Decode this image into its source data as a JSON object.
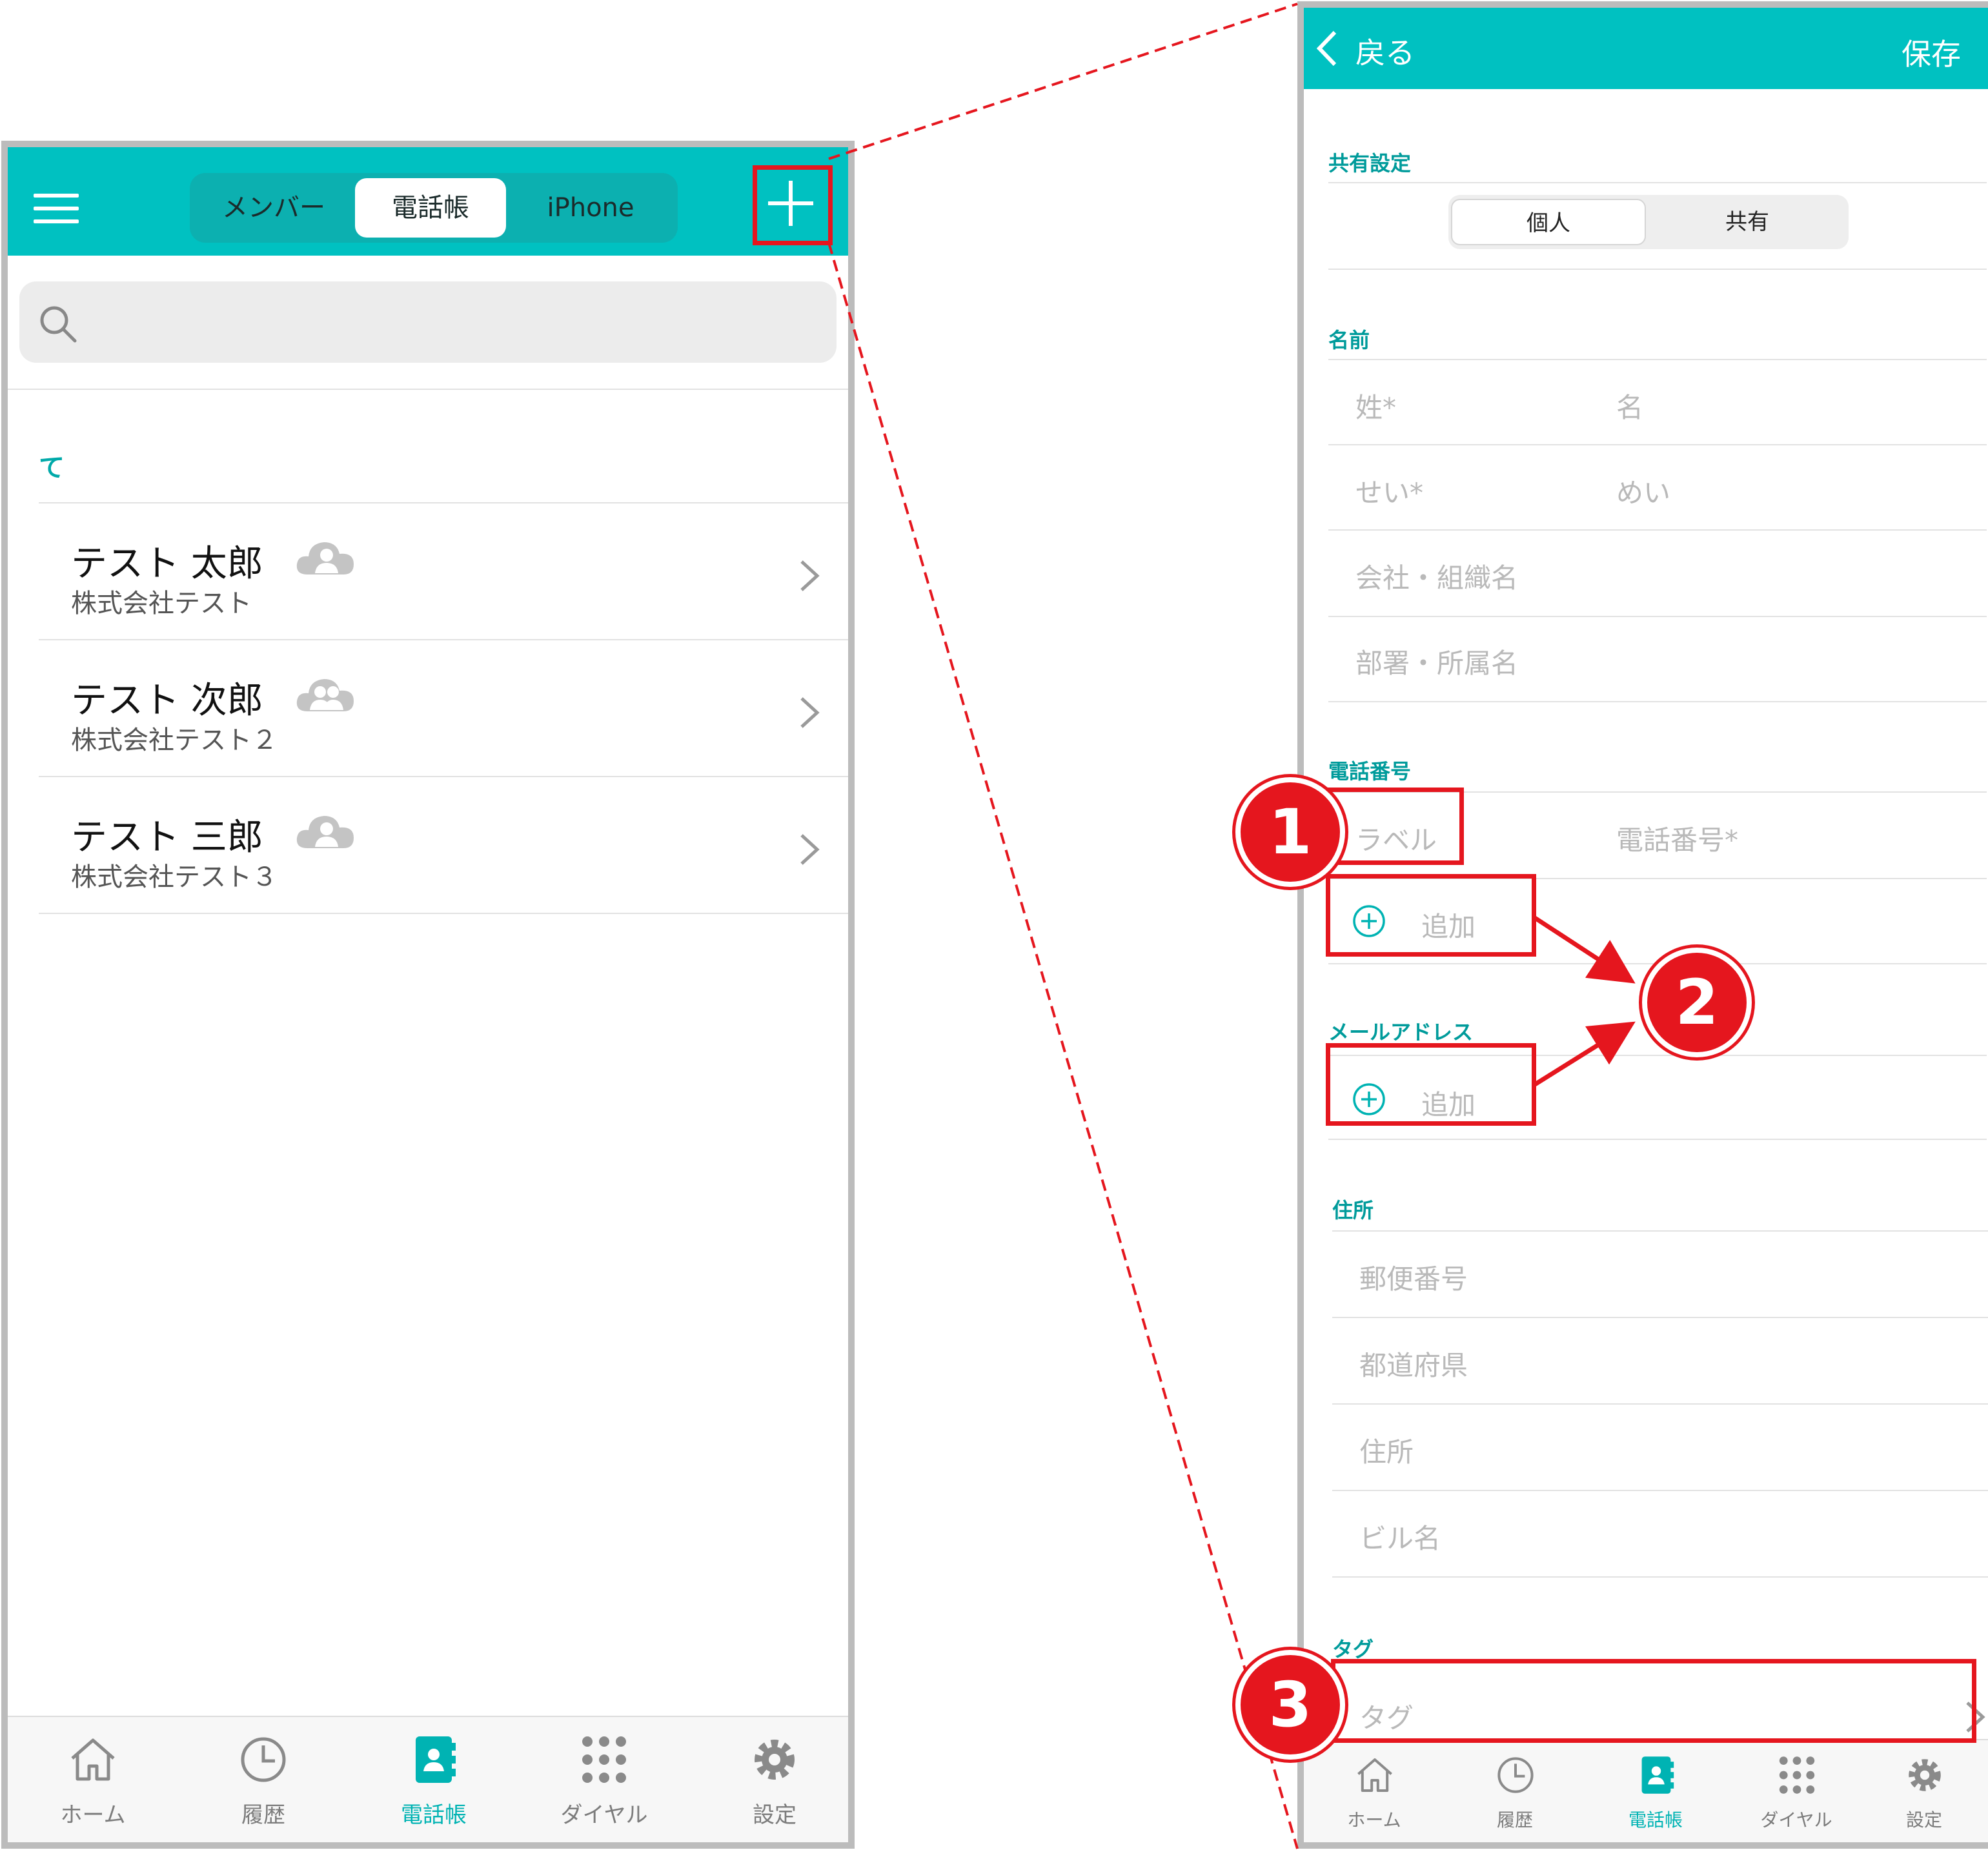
{
  "left": {
    "segments": [
      "メンバー",
      "電話帳",
      "iPhone"
    ],
    "active_segment": "電話帳",
    "section_letter": "て",
    "contacts": [
      {
        "name": "テスト 太郎",
        "company": "株式会社テスト"
      },
      {
        "name": "テスト 次郎",
        "company": "株式会社テスト２"
      },
      {
        "name": "テスト 三郎",
        "company": "株式会社テスト３"
      }
    ]
  },
  "tabbar": {
    "items": [
      {
        "label": "ホーム",
        "icon": "home-icon"
      },
      {
        "label": "履歴",
        "icon": "clock-icon"
      },
      {
        "label": "電話帳",
        "icon": "phonebook-icon"
      },
      {
        "label": "ダイヤル",
        "icon": "dialpad-icon"
      },
      {
        "label": "設定",
        "icon": "gear-icon"
      }
    ],
    "active": "電話帳"
  },
  "right": {
    "back_label": "戻る",
    "save_label": "保存",
    "share": {
      "title": "共有設定",
      "options": [
        "個人",
        "共有"
      ],
      "selected": "個人"
    },
    "name": {
      "title": "名前",
      "last_name": "姓*",
      "first_name": "名",
      "last_kana": "せい*",
      "first_kana": "めい",
      "company": "会社・組織名",
      "department": "部署・所属名"
    },
    "phone": {
      "title": "電話番号",
      "label": "ラベル",
      "number": "電話番号*",
      "add": "追加"
    },
    "email": {
      "title": "メールアドレス",
      "add": "追加"
    },
    "address": {
      "title": "住所",
      "postal": "郵便番号",
      "prefecture": "都道府県",
      "address": "住所",
      "building": "ビル名"
    },
    "tag": {
      "title": "タグ",
      "placeholder": "タグ"
    }
  },
  "annotations": {
    "badge1": "1",
    "badge2": "2",
    "badge3": "3"
  },
  "colors": {
    "accent": "#00c1c1",
    "annotation": "#e5161e"
  }
}
